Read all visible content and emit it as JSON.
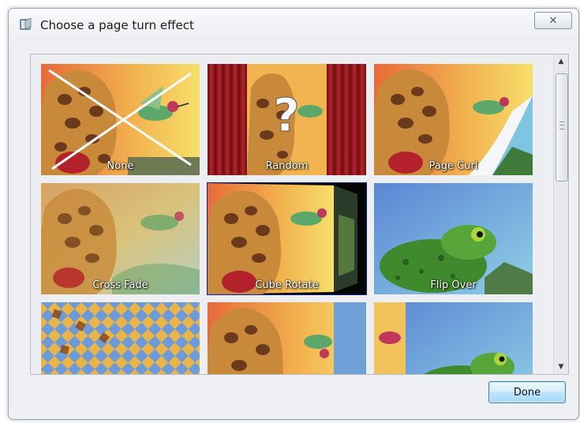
{
  "window": {
    "title": "Choose a page turn effect",
    "close_glyph": "✕"
  },
  "effects": [
    {
      "label": "None",
      "selected": false
    },
    {
      "label": "Random",
      "selected": false
    },
    {
      "label": "Page Curl",
      "selected": false
    },
    {
      "label": "Cross Fade",
      "selected": false
    },
    {
      "label": "Cube Rotate",
      "selected": true
    },
    {
      "label": "Flip Over",
      "selected": false
    },
    {
      "label": "",
      "selected": false
    },
    {
      "label": "",
      "selected": false
    },
    {
      "label": "",
      "selected": false
    }
  ],
  "scrollbar": {
    "up_glyph": "▲",
    "down_glyph": "▼"
  },
  "footer": {
    "done_label": "Done"
  },
  "colors": {
    "selection": "#0c1a9c",
    "window_bg": "#eef0f3"
  }
}
